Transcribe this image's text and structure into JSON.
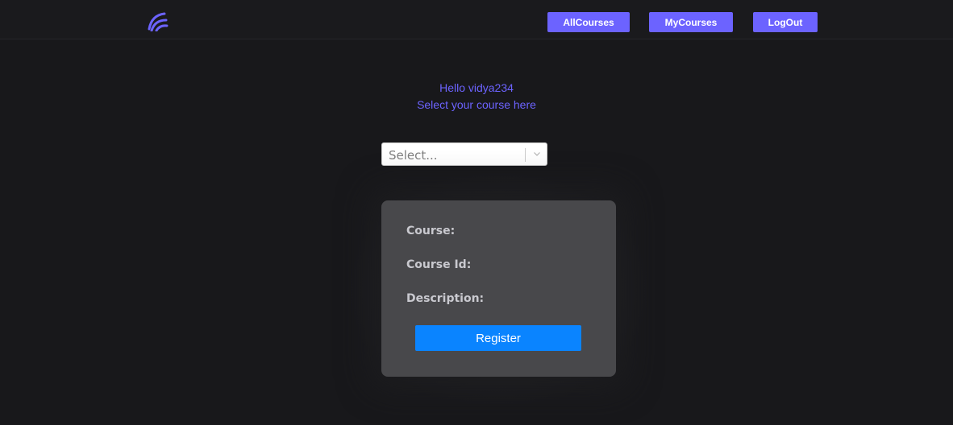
{
  "navbar": {
    "logo_icon": "wave-logo-icon",
    "links": {
      "all_courses": "AllCourses",
      "my_courses": "MyCourses",
      "logout": "LogOut"
    }
  },
  "main": {
    "greeting": "Hello vidya234",
    "instruction": "Select your course here",
    "course_select": {
      "placeholder": "Select...",
      "arrow_icon": "chevron-down-icon"
    },
    "details_card": {
      "course_label": "Course:",
      "course_id_label": "Course Id:",
      "description_label": "Description:",
      "register_label": "Register"
    }
  },
  "colors": {
    "background": "#18181b",
    "accent": "#6c63ff",
    "card": "#48484b",
    "register_button": "#0a84ff"
  }
}
